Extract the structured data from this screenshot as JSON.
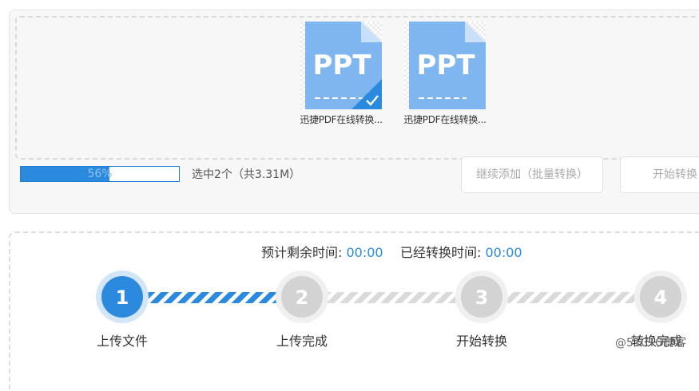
{
  "files": [
    {
      "type_label": "PPT",
      "name": "迅捷PDF在线转换...",
      "checked": true
    },
    {
      "type_label": "PPT",
      "name": "迅捷PDF在线转换...",
      "checked": false
    }
  ],
  "progress": {
    "percent": 56,
    "text": "56%"
  },
  "selection_info": "选中2个（共3.31M）",
  "buttons": {
    "add_more": "继续添加（批量转换）",
    "start": "开始转换"
  },
  "timers": {
    "remaining_label": "预计剩余时间:",
    "remaining_value": "00:00",
    "elapsed_label": "已经转换时间:",
    "elapsed_value": "00:00"
  },
  "steps": [
    {
      "number": "1",
      "label": "上传文件",
      "active": true
    },
    {
      "number": "2",
      "label": "上传完成",
      "active": false
    },
    {
      "number": "3",
      "label": "开始转换",
      "active": false
    },
    {
      "number": "4",
      "label": "转换完成",
      "active": false
    }
  ],
  "watermark": "@51CTO博客",
  "colors": {
    "accent": "#2b8ade",
    "doc": "#7fb6f0",
    "inactive": "#d3d3d3"
  }
}
